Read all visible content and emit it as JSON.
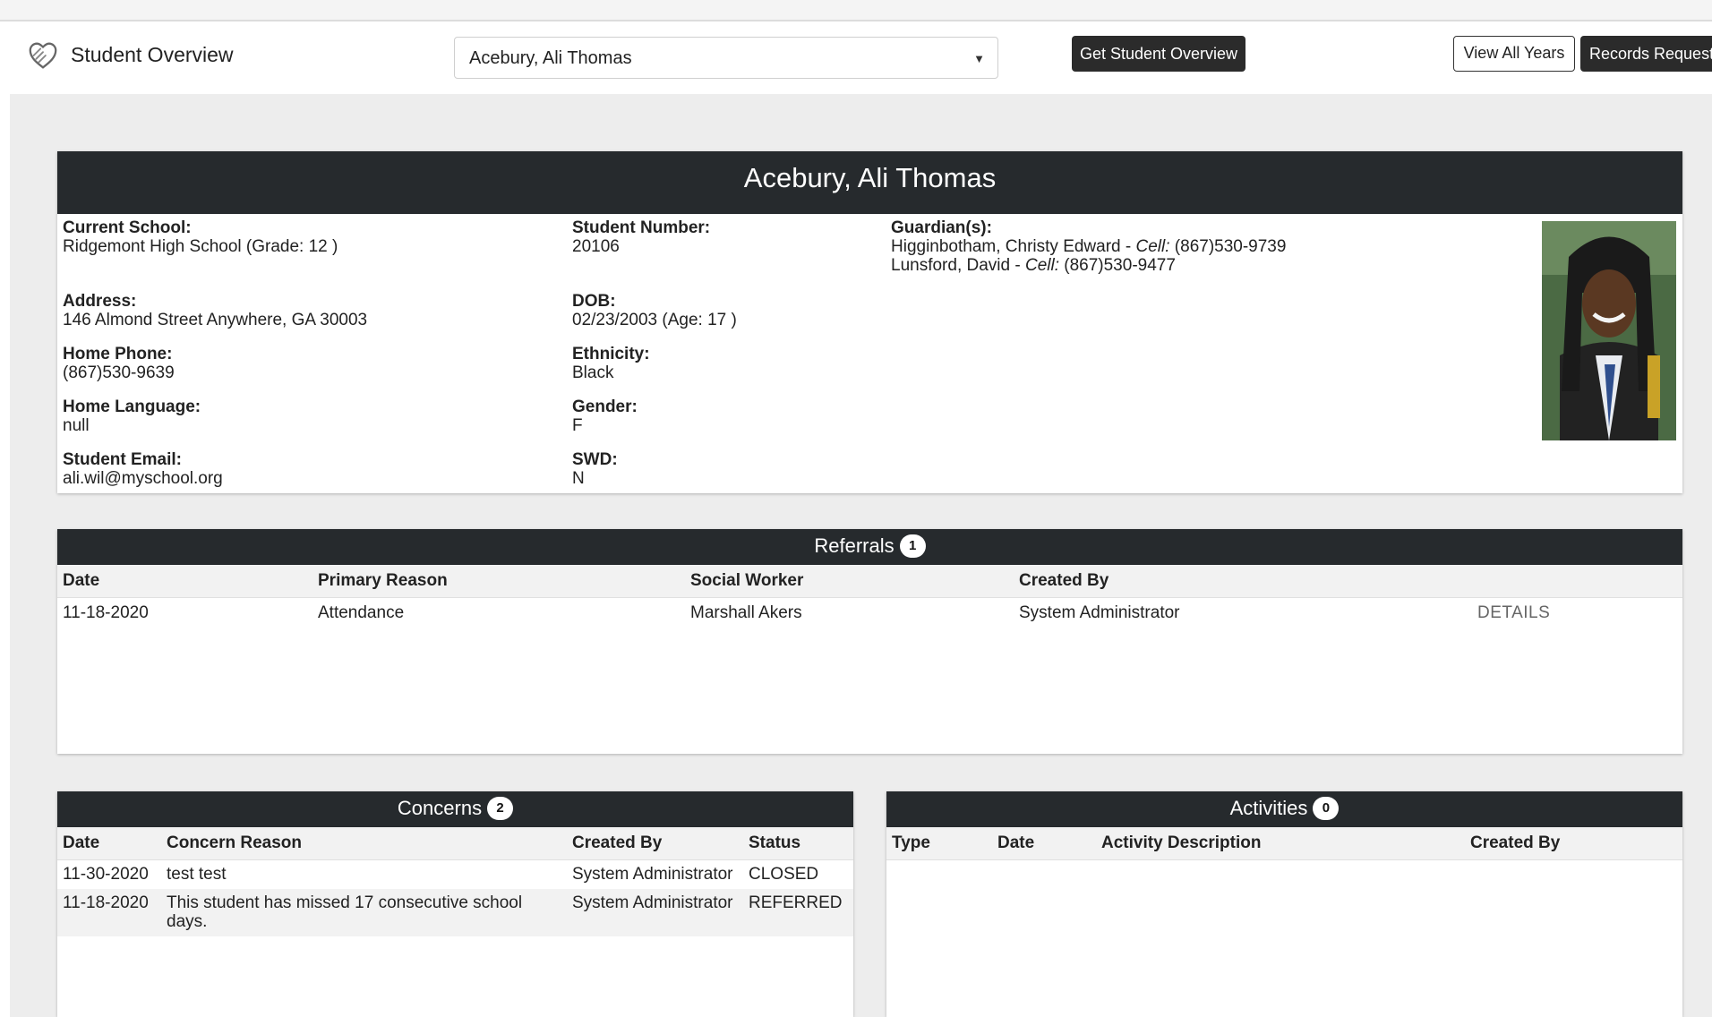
{
  "app": {
    "title": "Student Overview"
  },
  "header": {
    "student_select_value": "Acebury, Ali Thomas",
    "get_overview_label": "Get Student Overview",
    "view_all_years_label": "View All Years",
    "records_request_label": "Records Request"
  },
  "profile": {
    "name": "Acebury, Ali Thomas",
    "current_school_label": "Current School:",
    "current_school": "Ridgemont High School (Grade: 12 )",
    "address_label": "Address:",
    "address": "146 Almond Street Anywhere, GA 30003",
    "home_phone_label": "Home Phone:",
    "home_phone": "(867)530-9639",
    "home_language_label": "Home Language:",
    "home_language": "null",
    "student_email_label": "Student Email:",
    "student_email": "ali.wil@myschool.org",
    "student_number_label": "Student Number:",
    "student_number": "20106",
    "dob_label": "DOB:",
    "dob": "02/23/2003 (Age: 17 )",
    "ethnicity_label": "Ethnicity:",
    "ethnicity": "Black",
    "gender_label": "Gender:",
    "gender": "F",
    "swd_label": "SWD:",
    "swd": "N",
    "guardians_label": "Guardian(s):",
    "cell_label": "Cell:",
    "guardians": [
      {
        "name": "Higginbotham, Christy Edward - ",
        "cell": " (867)530-9739"
      },
      {
        "name": "Lunsford, David - ",
        "cell": " (867)530-9477"
      }
    ]
  },
  "referrals": {
    "title": "Referrals",
    "count": "1",
    "columns": [
      "Date",
      "Primary Reason",
      "Social Worker",
      "Created By",
      ""
    ],
    "rows": [
      {
        "date": "11-18-2020",
        "reason": "Attendance",
        "social_worker": "Marshall Akers",
        "created_by": "System Administrator",
        "action": "DETAILS"
      }
    ]
  },
  "concerns": {
    "title": "Concerns",
    "count": "2",
    "columns": [
      "Date",
      "Concern Reason",
      "Created By",
      "Status"
    ],
    "rows": [
      {
        "date": "11-30-2020",
        "reason": "test test",
        "created_by": "System Administrator",
        "status": "CLOSED"
      },
      {
        "date": "11-18-2020",
        "reason": "This student has missed 17 consecutive school days.",
        "created_by": "System Administrator",
        "status": "REFERRED"
      }
    ]
  },
  "activities": {
    "title": "Activities",
    "count": "0",
    "columns": [
      "Type",
      "Date",
      "Activity Description",
      "Created By"
    ]
  },
  "icons": {
    "logo": "hands-heart-icon",
    "dropdown": "caret-down-icon"
  },
  "colors": {
    "header_dark": "#262a2d",
    "button_dark": "#2b2b2b",
    "page_bg": "#ededed"
  }
}
